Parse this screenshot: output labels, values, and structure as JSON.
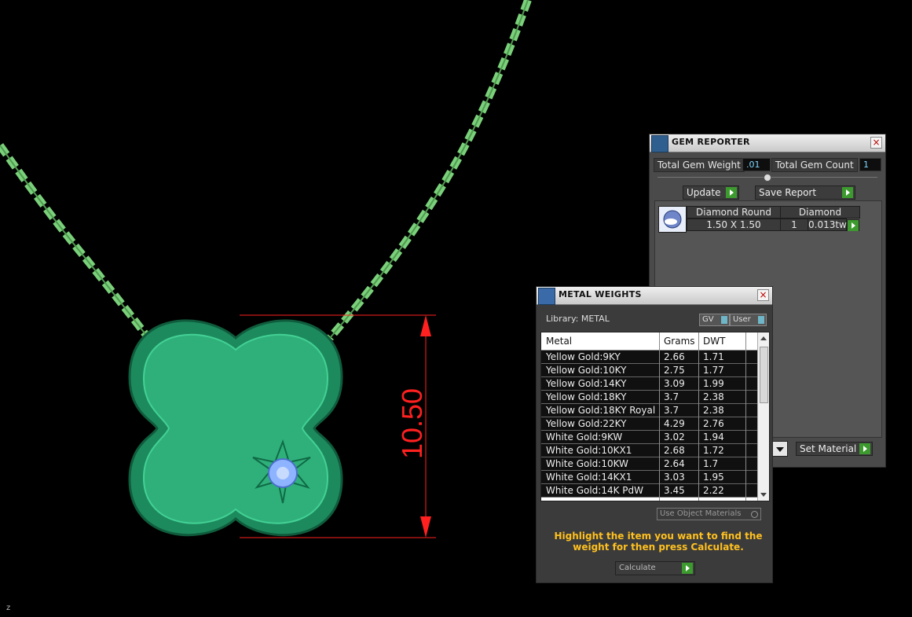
{
  "viewport": {
    "dimension_label": "10.50",
    "axis_label": "z",
    "colors": {
      "chain": "#7bd07b",
      "pendant": "#2fb07a",
      "dimension": "#ff2020",
      "gem": "#8fb4ff"
    }
  },
  "gem_reporter": {
    "title": "GEM REPORTER",
    "total_weight_label": "Total Gem Weight",
    "total_weight_value": ".01",
    "total_count_label": "Total Gem Count",
    "total_count_value": "1",
    "update_label": "Update",
    "save_report_label": "Save Report",
    "set_material_label": "Set Material",
    "gem": {
      "name": "Diamond Round",
      "material": "Diamond",
      "size": "1.50 X 1.50",
      "count": "1",
      "weight": "0.013tw"
    }
  },
  "metal_weights": {
    "title": "METAL WEIGHTS",
    "library_label": "Library: METAL",
    "gv_label": "GV",
    "user_label": "User",
    "columns": [
      "Metal",
      "Grams",
      "DWT"
    ],
    "rows": [
      {
        "metal": "Yellow Gold:9KY",
        "grams": "2.66",
        "dwt": "1.71"
      },
      {
        "metal": "Yellow Gold:10KY",
        "grams": "2.75",
        "dwt": "1.77"
      },
      {
        "metal": "Yellow Gold:14KY",
        "grams": "3.09",
        "dwt": "1.99"
      },
      {
        "metal": "Yellow Gold:18KY",
        "grams": "3.7",
        "dwt": "2.38"
      },
      {
        "metal": "Yellow Gold:18KY Royal",
        "grams": "3.7",
        "dwt": "2.38"
      },
      {
        "metal": "Yellow Gold:22KY",
        "grams": "4.29",
        "dwt": "2.76"
      },
      {
        "metal": "White Gold:9KW",
        "grams": "3.02",
        "dwt": "1.94"
      },
      {
        "metal": "White Gold:10KX1",
        "grams": "2.68",
        "dwt": "1.72"
      },
      {
        "metal": "White Gold:10KW",
        "grams": "2.64",
        "dwt": "1.7"
      },
      {
        "metal": "White Gold:14KX1",
        "grams": "3.03",
        "dwt": "1.95"
      },
      {
        "metal": "White Gold:14K PdW",
        "grams": "3.45",
        "dwt": "2.22"
      }
    ],
    "use_object_materials_label": "Use Object Materials",
    "hint": "Highlight the item you want to find the weight for then press Calculate.",
    "calculate_label": "Calculate"
  }
}
